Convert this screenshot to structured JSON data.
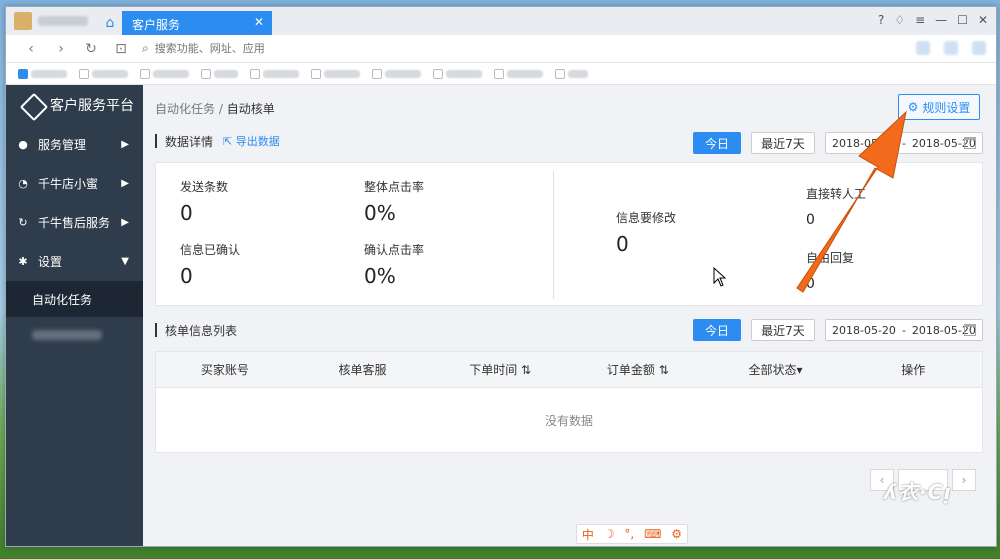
{
  "browser": {
    "active_tab_title": "客户服务",
    "address_placeholder": "搜索功能、网址、应用"
  },
  "sidebar": {
    "brand": "客户服务平台",
    "items": [
      {
        "label": "服务管理",
        "icon": "bell-icon",
        "arrow": "▶"
      },
      {
        "label": "千牛店小蜜",
        "icon": "clock-icon",
        "arrow": "▶"
      },
      {
        "label": "千牛售后服务",
        "icon": "refresh-icon",
        "arrow": "▶"
      },
      {
        "label": "设置",
        "icon": "gear-icon",
        "arrow": "▼"
      }
    ],
    "active_sub": "自动化任务"
  },
  "breadcrumb": {
    "parent": "自动化任务",
    "sep": " / ",
    "current": "自动核单"
  },
  "rule_button": "规则设置",
  "data_details": {
    "title": "数据详情",
    "export": "导出数据",
    "today": "今日",
    "last7": "最近7天",
    "date_start": "2018-05-20",
    "date_sep": "-",
    "date_end": "2018-05-20",
    "stats": {
      "sent_label": "发送条数",
      "sent_value": "0",
      "click_rate_label": "整体点击率",
      "click_rate_value": "0%",
      "confirmed_label": "信息已确认",
      "confirmed_value": "0",
      "confirm_rate_label": "确认点击率",
      "confirm_rate_value": "0%",
      "modify_label": "信息要修改",
      "modify_value": "0",
      "transfer_label": "直接转人工",
      "transfer_value": "0",
      "reply_label": "自由回复",
      "reply_value": "0"
    }
  },
  "order_list": {
    "title": "核单信息列表",
    "today": "今日",
    "last7": "最近7天",
    "date_start": "2018-05-20",
    "date_sep": "-",
    "date_end": "2018-05-20",
    "columns": [
      "买家账号",
      "核单客服",
      "下单时间 ⇅",
      "订单金额 ⇅",
      "全部状态▾",
      "操作"
    ],
    "empty": "没有数据"
  },
  "ime": [
    "中",
    "☽",
    "°,",
    "⌨",
    "⚙"
  ],
  "watermark": "ʎ衣·Cᴉ",
  "colors": {
    "accent": "#2d8cf0",
    "sidebar": "#2f3c4b",
    "arrow": "#f26b1d"
  }
}
